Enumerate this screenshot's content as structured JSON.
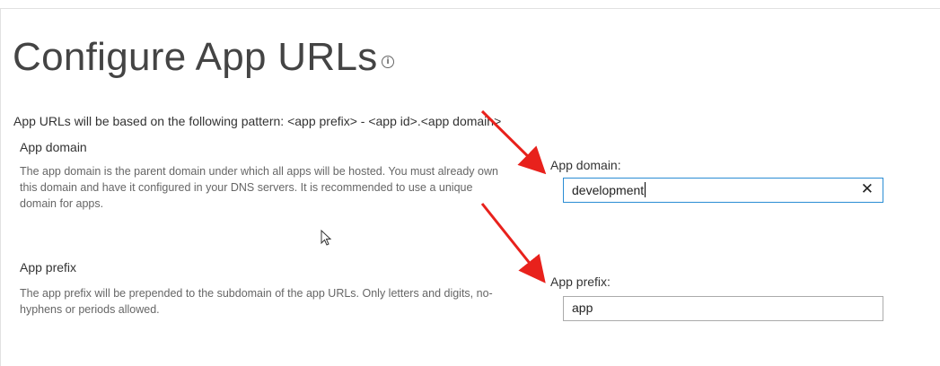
{
  "page": {
    "title": "Configure App URLs",
    "info_icon": "info-icon",
    "pattern_text": "App URLs will be based on the following pattern: <app prefix> - <app id>.<app domain>"
  },
  "app_domain_section": {
    "heading": "App domain",
    "description": "The app domain is the parent domain under which all apps will be hosted. You must already own this domain and have it configured in your DNS servers. It is recommended to use a unique domain for apps.",
    "field_label": "App domain:",
    "value": "development",
    "clear_icon": "close-icon"
  },
  "app_prefix_section": {
    "heading": "App prefix",
    "description": "The app prefix will be prepended to the subdomain of the app URLs. Only letters and digits, no-hyphens or periods allowed.",
    "field_label": "App prefix:",
    "value": "app"
  },
  "annotations": {
    "arrow_color": "#e8211c",
    "arrow_count": 3
  },
  "colors": {
    "focus_border": "#2a8dd4",
    "input_border": "#ababab",
    "title_text": "#444444"
  }
}
